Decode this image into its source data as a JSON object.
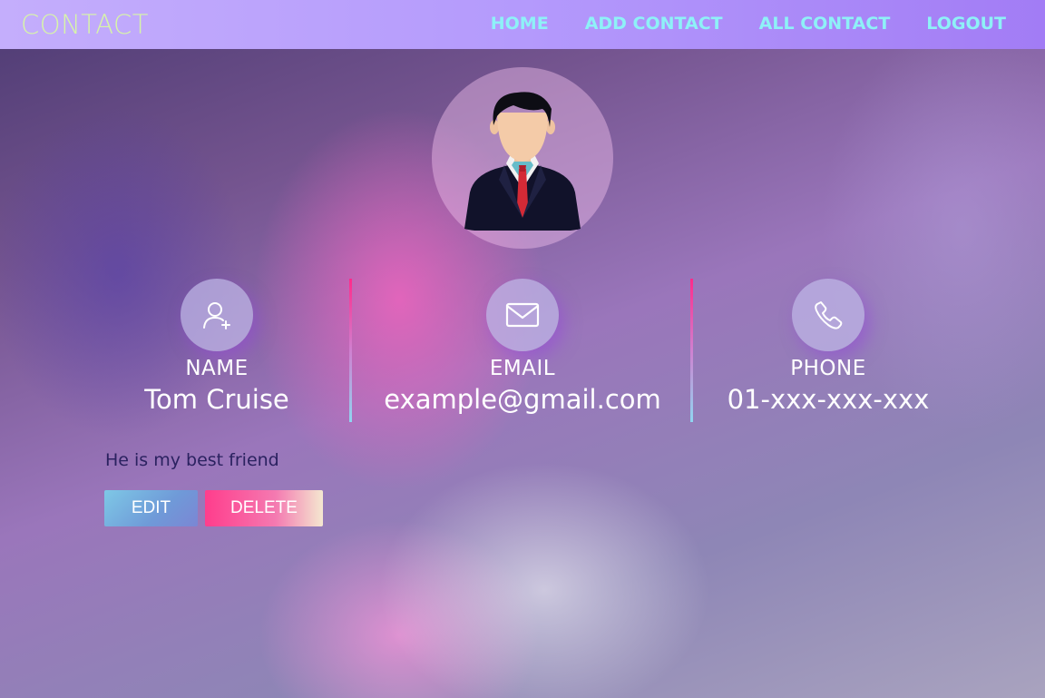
{
  "navbar": {
    "brand": "CONTACT",
    "links": [
      "HOME",
      "ADD CONTACT",
      "ALL CONTACT",
      "LOGOUT"
    ]
  },
  "contact": {
    "name_label": "NAME",
    "name": "Tom Cruise",
    "email_label": "EMAIL",
    "email": "example@gmail.com",
    "phone_label": "PHONE",
    "phone": "01-xxx-xxx-xxx",
    "note": "He is my best friend"
  },
  "actions": {
    "edit_label": "EDIT",
    "delete_label": "DELETE"
  },
  "icons": {
    "avatar": "person-avatar-icon",
    "name": "add-user-icon",
    "email": "envelope-icon",
    "phone": "phone-icon"
  },
  "colors": {
    "brand": "#d7f5a8",
    "nav_link": "#8ef1f7",
    "navbar_start": "#c4aefc",
    "navbar_end": "#a27cf5",
    "divider_top": "#ff2a8a",
    "divider_bottom": "#8fd6f0"
  }
}
